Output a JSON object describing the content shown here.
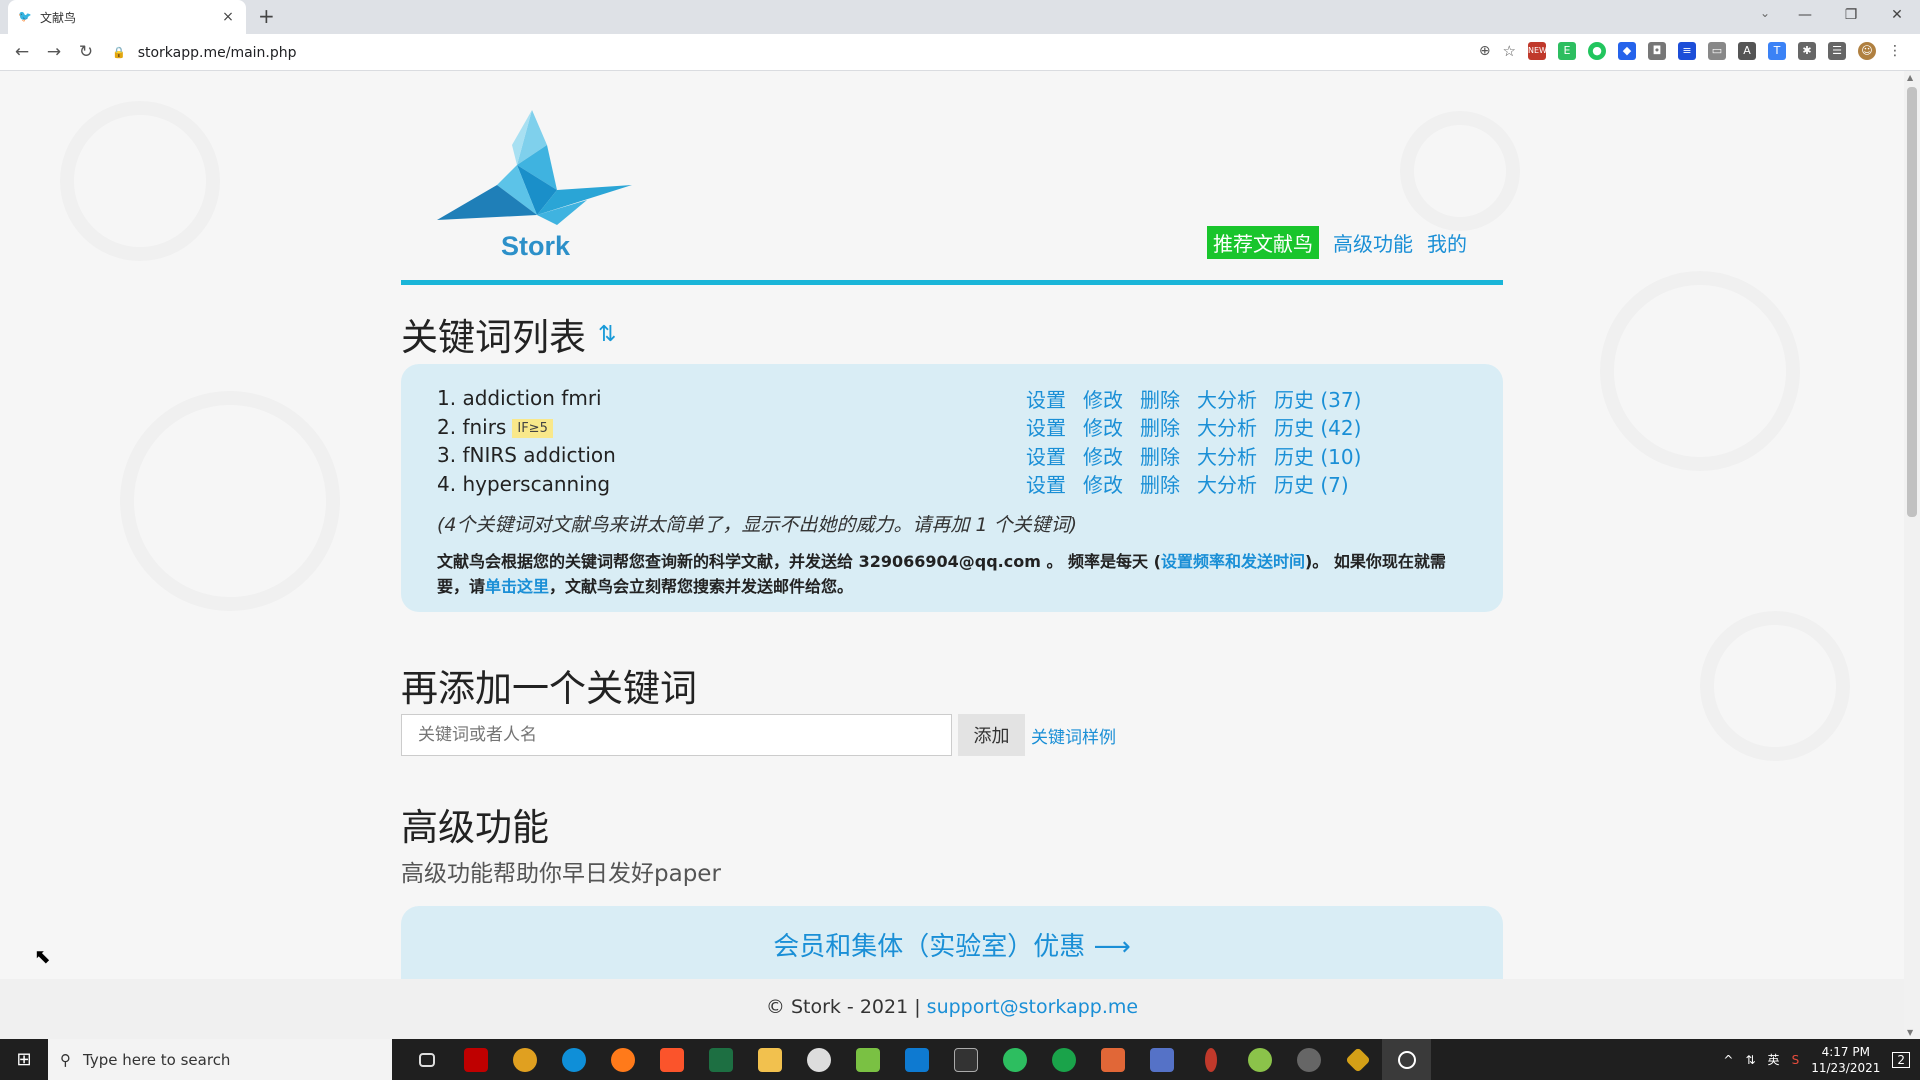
{
  "browser": {
    "tab_title": "文献鸟",
    "url": "storkapp.me/main.php"
  },
  "header": {
    "logo_text": "Stork",
    "nav": {
      "recommend": "推荐文献鸟",
      "advanced": "高级功能",
      "mine": "我的"
    }
  },
  "keywords": {
    "title": "关键词列表",
    "items": [
      {
        "name": "1. addiction fmri",
        "badge": "",
        "history": "历史 (37)"
      },
      {
        "name": "2. fnirs",
        "badge": "IF≥5",
        "history": "历史 (42)"
      },
      {
        "name": "3. fNIRS addiction",
        "badge": "",
        "history": "历史 (10)"
      },
      {
        "name": "4. hyperscanning",
        "badge": "",
        "history": "历史 (7)"
      }
    ],
    "actions": {
      "settings": "设置",
      "edit": "修改",
      "delete": "删除",
      "analysis": "大分析"
    },
    "note": "(4个关键词对文献鸟来讲太简单了，显示不出她的威力。请再加 1 个关键词)",
    "info_part1": "文献鸟会根据您的关键词帮您查询新的科学文献，并发送给 329066904@qq.com 。 频率是每天 (",
    "info_link1": "设置频率和发送时间",
    "info_part2": ")。 如果你现在就需要，请",
    "info_link2": "单击这里",
    "info_part3": "，文献鸟会立刻帮您搜索并发送邮件给您。"
  },
  "add_keyword": {
    "title": "再添加一个关键词",
    "placeholder": "关键词或者人名",
    "button": "添加",
    "example_link": "关键词样例"
  },
  "advanced": {
    "title": "高级功能",
    "subtitle": "高级功能帮助你早日发好paper",
    "member_link": "会员和集体（实验室）优惠 ⟶"
  },
  "footer": {
    "copyright": "© Stork - 2021 |",
    "email": "support@storkapp.me"
  },
  "taskbar": {
    "search_placeholder": "Type here to search",
    "time": "4:17 PM",
    "date": "11/23/2021",
    "lang": "英",
    "notifications": "2"
  },
  "colors": {
    "accent": "#1ab5d8",
    "link": "#1a8fd6",
    "recommend_bg": "#19c52c",
    "box_bg": "#d9edf5"
  }
}
